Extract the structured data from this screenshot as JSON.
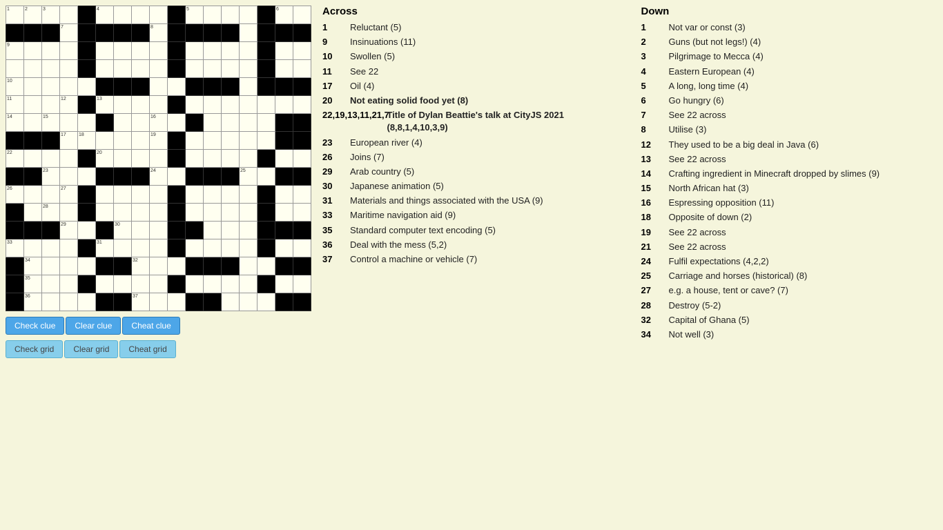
{
  "buttons": {
    "check_clue": "Check clue",
    "clear_clue": "Clear clue",
    "cheat_clue": "Cheat clue",
    "check_grid": "Check grid",
    "clear_grid": "Clear grid",
    "cheat_grid": "Cheat grid"
  },
  "across_title": "Across",
  "down_title": "Down",
  "across_clues": [
    {
      "num": "1",
      "text": "Reluctant (5)"
    },
    {
      "num": "9",
      "text": "Insinuations (11)"
    },
    {
      "num": "10",
      "text": "Swollen (5)"
    },
    {
      "num": "11",
      "text": "See 22"
    },
    {
      "num": "17",
      "text": "Oil (4)"
    },
    {
      "num": "20",
      "text": "Not eating solid food yet (8)",
      "bold": true
    },
    {
      "num": "22,19,13,11,21,7",
      "text": "Title of Dylan Beattie's talk at CityJS 2021 (8,8,1,4,10,3,9)",
      "special": true
    },
    {
      "num": "23",
      "text": "European river (4)"
    },
    {
      "num": "26",
      "text": "Joins (7)"
    },
    {
      "num": "29",
      "text": "Arab country (5)"
    },
    {
      "num": "30",
      "text": "Japanese animation (5)"
    },
    {
      "num": "31",
      "text": "Materials and things associated with the USA (9)"
    },
    {
      "num": "33",
      "text": "Maritime navigation aid (9)"
    },
    {
      "num": "35",
      "text": "Standard computer text encoding (5)"
    },
    {
      "num": "36",
      "text": "Deal with the mess (5,2)"
    },
    {
      "num": "37",
      "text": "Control a machine or vehicle (7)"
    }
  ],
  "down_clues": [
    {
      "num": "1",
      "text": "Not var or const (3)"
    },
    {
      "num": "2",
      "text": "Guns (but not legs!) (4)"
    },
    {
      "num": "3",
      "text": "Pilgrimage to Mecca (4)"
    },
    {
      "num": "4",
      "text": "Eastern European (4)"
    },
    {
      "num": "5",
      "text": "A long, long time (4)"
    },
    {
      "num": "6",
      "text": "Go hungry (6)"
    },
    {
      "num": "7",
      "text": "See 22 across"
    },
    {
      "num": "8",
      "text": "Utilise (3)"
    },
    {
      "num": "12",
      "text": "They used to be a big deal in Java (6)"
    },
    {
      "num": "13",
      "text": "See 22 across"
    },
    {
      "num": "14",
      "text": "Crafting ingredient in Minecraft dropped by slimes (9)"
    },
    {
      "num": "15",
      "text": "North African hat (3)"
    },
    {
      "num": "16",
      "text": "Espressing opposition (11)"
    },
    {
      "num": "18",
      "text": "Opposite of down (2)"
    },
    {
      "num": "19",
      "text": "See 22 across"
    },
    {
      "num": "21",
      "text": "See 22 across"
    },
    {
      "num": "24",
      "text": "Fulfil expectations (4,2,2)"
    },
    {
      "num": "25",
      "text": "Carriage and horses (historical) (8)"
    },
    {
      "num": "27",
      "text": "e.g. a house, tent or cave? (7)"
    },
    {
      "num": "28",
      "text": "Destroy (5-2)"
    },
    {
      "num": "32",
      "text": "Capital of Ghana (5)"
    },
    {
      "num": "34",
      "text": "Not well (3)"
    }
  ]
}
